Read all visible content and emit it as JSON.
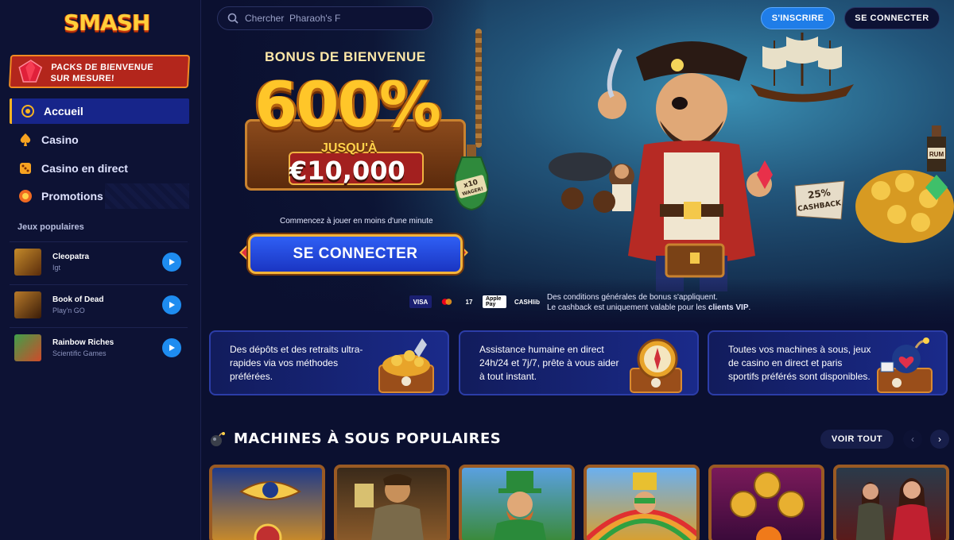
{
  "brand": {
    "logo_text": "SMASH"
  },
  "header": {
    "search_placeholder": "Chercher  Pharaoh's F",
    "signup_label": "S'INSCRIRE",
    "login_label": "SE CONNECTER"
  },
  "sidebar": {
    "welcome_banner": "PACKS DE BIENVENUE SUR MESURE!",
    "nav": [
      {
        "label": "Accueil",
        "icon": "home-icon",
        "active": true
      },
      {
        "label": "Casino",
        "icon": "spade-icon"
      },
      {
        "label": "Casino en direct",
        "icon": "dice-icon"
      },
      {
        "label": "Promotions",
        "icon": "promo-icon"
      }
    ],
    "popular_label": "Jeux populaires",
    "games": [
      {
        "name": "Cleopatra",
        "provider": "Igt"
      },
      {
        "name": "Book of Dead",
        "provider": "Play'n GO"
      },
      {
        "name": "Rainbow Riches",
        "provider": "Scientific Games"
      }
    ]
  },
  "hero": {
    "bonus_title": "BONUS DE BIENVENUE",
    "bonus_percent": "600%",
    "bonus_upto": "JUSQU'À",
    "bonus_amount": "€10,000",
    "bottle_label": "x10 WAGER!",
    "caption": "Commencez à jouer en moins d'une minute",
    "cta_label": "SE CONNECTER",
    "payment_methods": [
      "VISA",
      "mastercard",
      "17",
      "Apple Pay",
      "CASHlib"
    ],
    "terms_line1": "Des conditions générales de bonus s'appliquent.",
    "terms_line2_prefix": "Le cashback est uniquement valable pour les ",
    "terms_line2_bold": "clients VIP",
    "terms_line2_suffix": ".",
    "cashback_badge": "25% CASHBACK",
    "rum_label": "RUM"
  },
  "features": [
    {
      "text": "Des dépôts et des retraits ultra-rapides via vos méthodes préférées.",
      "art": "treasure-chest-icon"
    },
    {
      "text": "Assistance humaine en direct 24h/24 et 7j/7, prête à vous aider à tout instant.",
      "art": "compass-icon"
    },
    {
      "text": "Toutes vos machines à sous, jeux de casino en direct et paris sportifs préférés sont disponibles.",
      "art": "bomb-chest-icon"
    }
  ],
  "slots_section": {
    "title": "MACHINES À SOUS POPULAIRES",
    "see_all": "VOIR TOUT",
    "prev": "‹",
    "next": "›"
  },
  "colors": {
    "background": "#0b1030",
    "accent_blue": "#1f7de8",
    "gold": "#f4b43a",
    "active_nav": "#17258a"
  }
}
